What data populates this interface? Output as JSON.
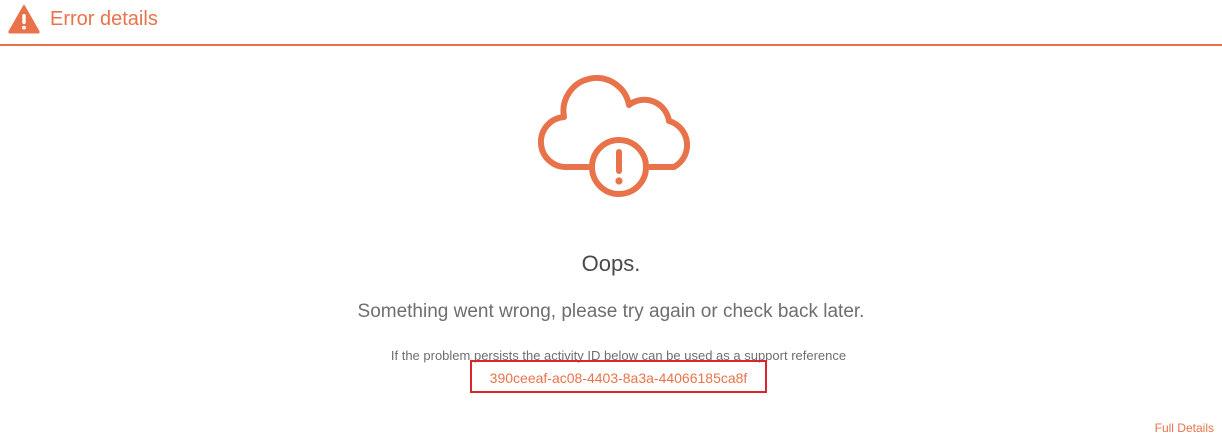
{
  "header": {
    "title": "Error details",
    "icon": "warning-triangle-icon"
  },
  "illustration": {
    "icon": "cloud-error-icon"
  },
  "content": {
    "heading": "Oops.",
    "message": "Something went wrong, please try again or check back later.",
    "support_text": "If the problem persists the activity ID below can be used as a support reference",
    "activity_id": "390ceeaf-ac08-4403-8a3a-44066185ca8f"
  },
  "footer": {
    "full_details_label": "Full Details"
  },
  "colors": {
    "accent": "#e8734a",
    "highlight_box": "#d9262c",
    "text_dark": "#4a4a4a",
    "text_muted": "#6e6e6e"
  }
}
